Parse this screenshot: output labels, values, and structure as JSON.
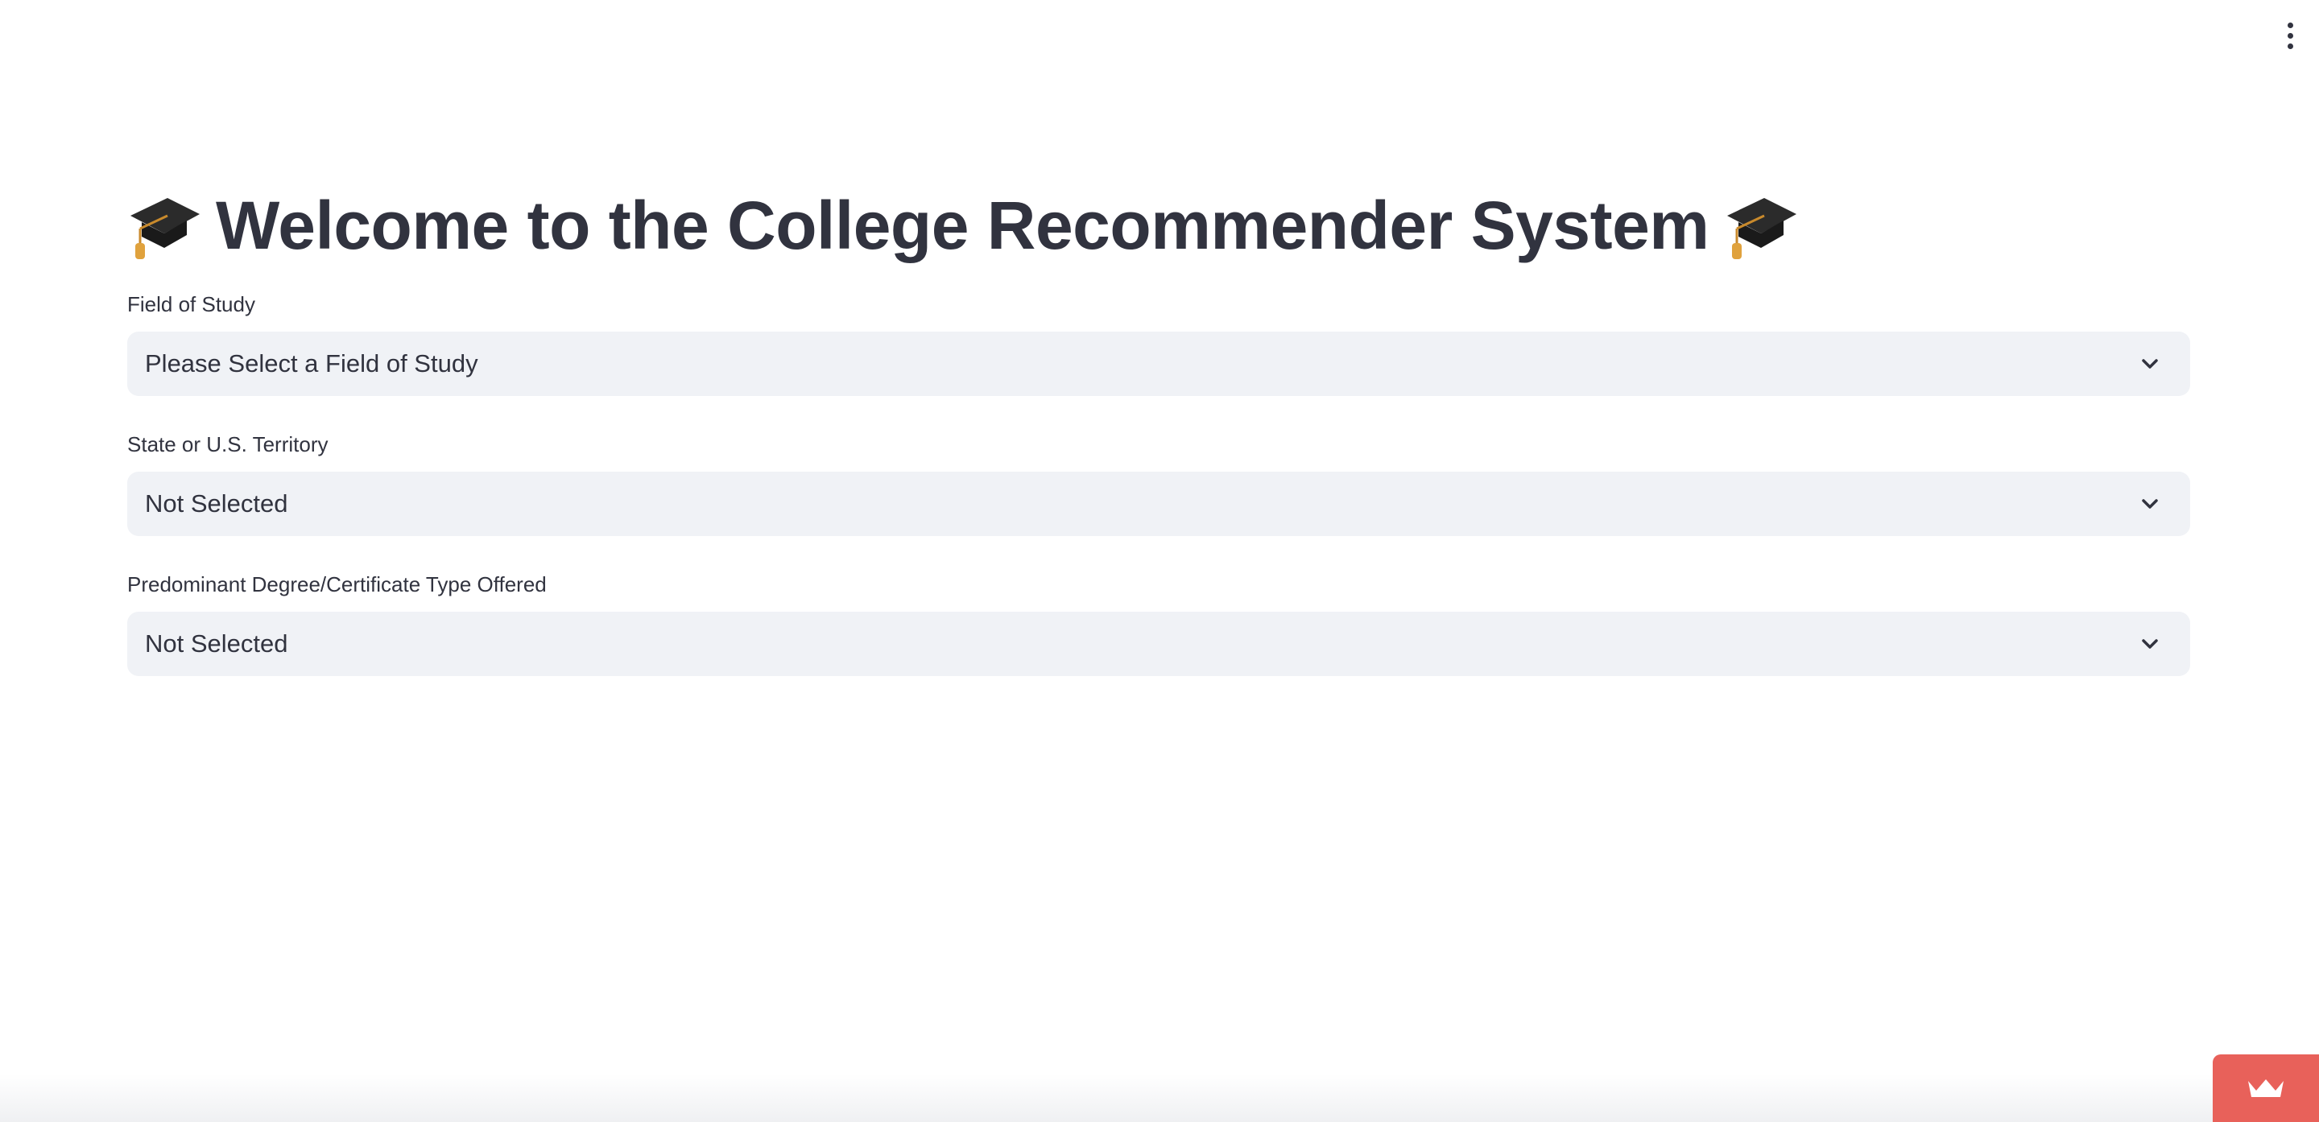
{
  "header": {
    "menu_icon": "kebab-menu-icon"
  },
  "main": {
    "title": "Welcome to the College Recommender System",
    "title_icon": "graduation-cap-icon"
  },
  "form": {
    "field_of_study": {
      "label": "Field of Study",
      "value": "Please Select a Field of Study"
    },
    "state": {
      "label": "State or U.S. Territory",
      "value": "Not Selected"
    },
    "degree_type": {
      "label": "Predominant Degree/Certificate Type Offered",
      "value": "Not Selected"
    }
  },
  "footer": {
    "badge_icon": "crown-icon",
    "badge_color": "#e8615a"
  },
  "colors": {
    "text": "#31333f",
    "select_bg": "#f0f2f6",
    "background": "#ffffff"
  }
}
